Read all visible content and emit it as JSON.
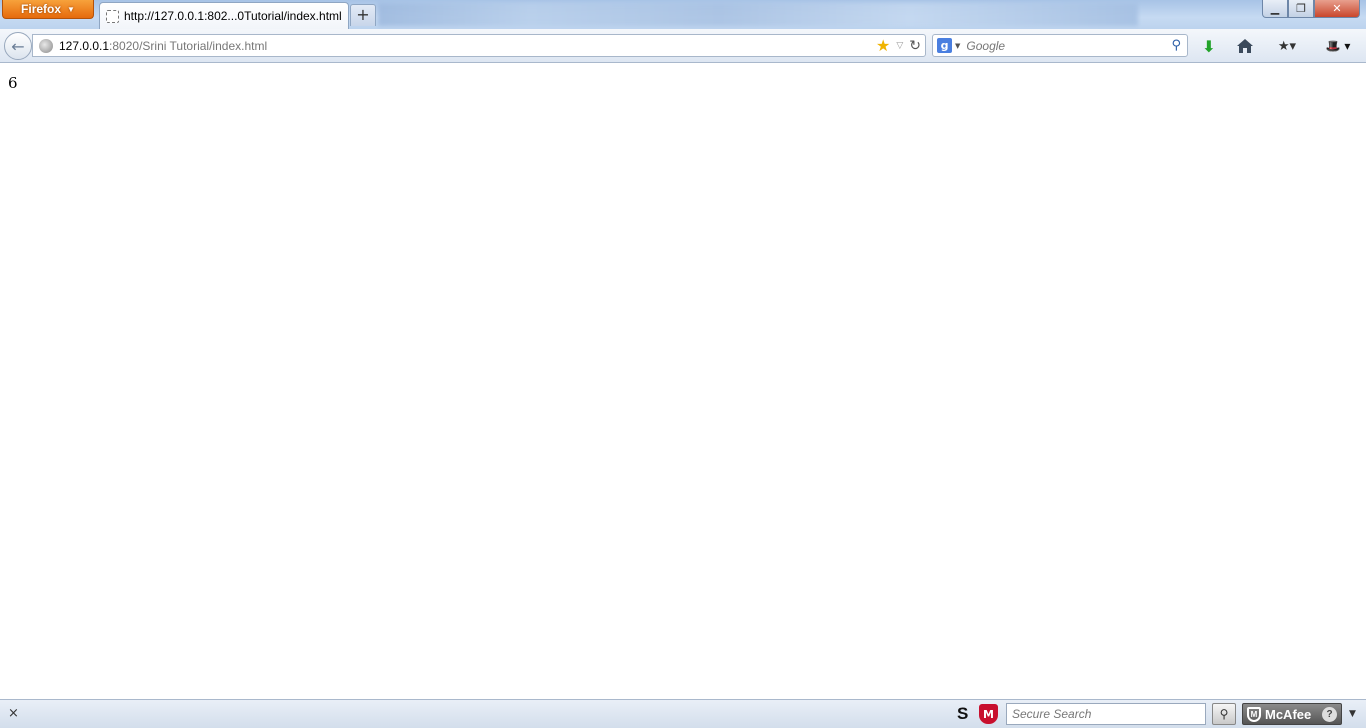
{
  "browser": {
    "menu_label": "Firefox",
    "menu_caret": "▼",
    "window_controls": {
      "minimize": "▁",
      "maximize": "❐",
      "close": "✕"
    }
  },
  "tabs": {
    "active_title": "http://127.0.0.1:802...0Tutorial/index.html",
    "new_tab_label": "+"
  },
  "navbar": {
    "back_glyph": "←",
    "url_host": "127.0.0.1",
    "url_rest": ":8020/Srini Tutorial/index.html",
    "star_glyph": "★",
    "dropdown_glyph": "▽",
    "reload_glyph": "↻",
    "search": {
      "engine_glyph": "g",
      "engine_caret": "▼",
      "placeholder": "Google",
      "search_glyph": "⚲"
    },
    "toolbar_icons": {
      "downloads": "download-icon",
      "home": "home-icon",
      "bookmarks": "bookmarks-icon",
      "addon": "hat-icon"
    },
    "download_glyph": "⬇",
    "bookmarks_glyph": "★▾",
    "addon_glyph": "🎩 ▾"
  },
  "content": {
    "output": "6"
  },
  "addon_bar": {
    "close_glyph": "×",
    "s_label": "S",
    "shield_glyph": "M",
    "secure_search_placeholder": "Secure Search",
    "search_btn_glyph": "⚲",
    "mcafee_label": "McAfee",
    "mcafee_shield_glyph": "M",
    "help_glyph": "?",
    "caret_glyph": "▼"
  }
}
